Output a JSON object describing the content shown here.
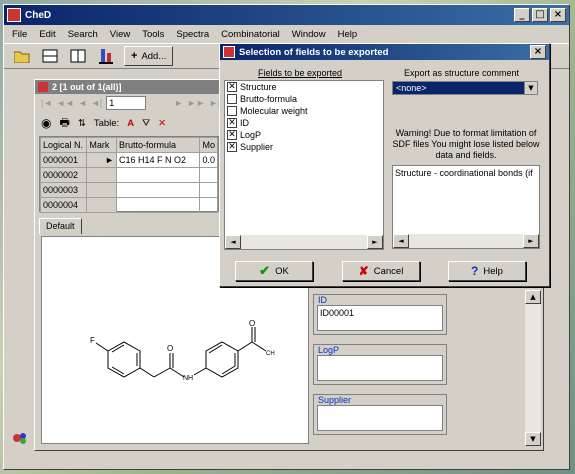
{
  "app": {
    "title": "CheD"
  },
  "menu": [
    "File",
    "Edit",
    "Search",
    "View",
    "Tools",
    "Spectra",
    "Combinatorial",
    "Window",
    "Help"
  ],
  "toolbar": {
    "add_label": "Add..."
  },
  "child": {
    "title": "2 [1 out of 1(all)]",
    "nav_value": "1",
    "table_label": "Table:",
    "columns": [
      "Logical N.",
      "Mark",
      "Brutto-formula",
      "Mo"
    ],
    "rows": [
      {
        "id": "0000001",
        "mark": "►",
        "formula": "C16 H14 F N O2",
        "mo": "0.0"
      },
      {
        "id": "0000002",
        "mark": "",
        "formula": "",
        "mo": ""
      },
      {
        "id": "0000003",
        "mark": "",
        "formula": "",
        "mo": ""
      },
      {
        "id": "0000004",
        "mark": "",
        "formula": "",
        "mo": ""
      }
    ],
    "tab_default": "Default",
    "fields": {
      "id_label": "ID",
      "id_value": "ID00001",
      "logp_label": "LogP",
      "logp_value": "",
      "supplier_label": "Supplier",
      "supplier_value": ""
    },
    "structure": {
      "f_label": "F",
      "nh_label": "NH",
      "o_label": "O",
      "ch3_label": "CH"
    }
  },
  "dialog": {
    "title": "Selection of fields to be exported",
    "fields_heading": "Fields to be exported",
    "export_heading": "Export as structure comment",
    "fields": [
      {
        "label": "Structure",
        "checked": true
      },
      {
        "label": "Brutto-formula",
        "checked": false
      },
      {
        "label": "Molecular weight",
        "checked": false
      },
      {
        "label": "ID",
        "checked": true
      },
      {
        "label": "LogP",
        "checked": true
      },
      {
        "label": "Supplier",
        "checked": true
      }
    ],
    "export_selected": "<none>",
    "warning": "Warning! Due to format limitation of SDF files You might lose listed below data and fields.",
    "memo": "Structure - coordinational bonds (if",
    "ok_label": "OK",
    "cancel_label": "Cancel",
    "help_label": "Help"
  }
}
